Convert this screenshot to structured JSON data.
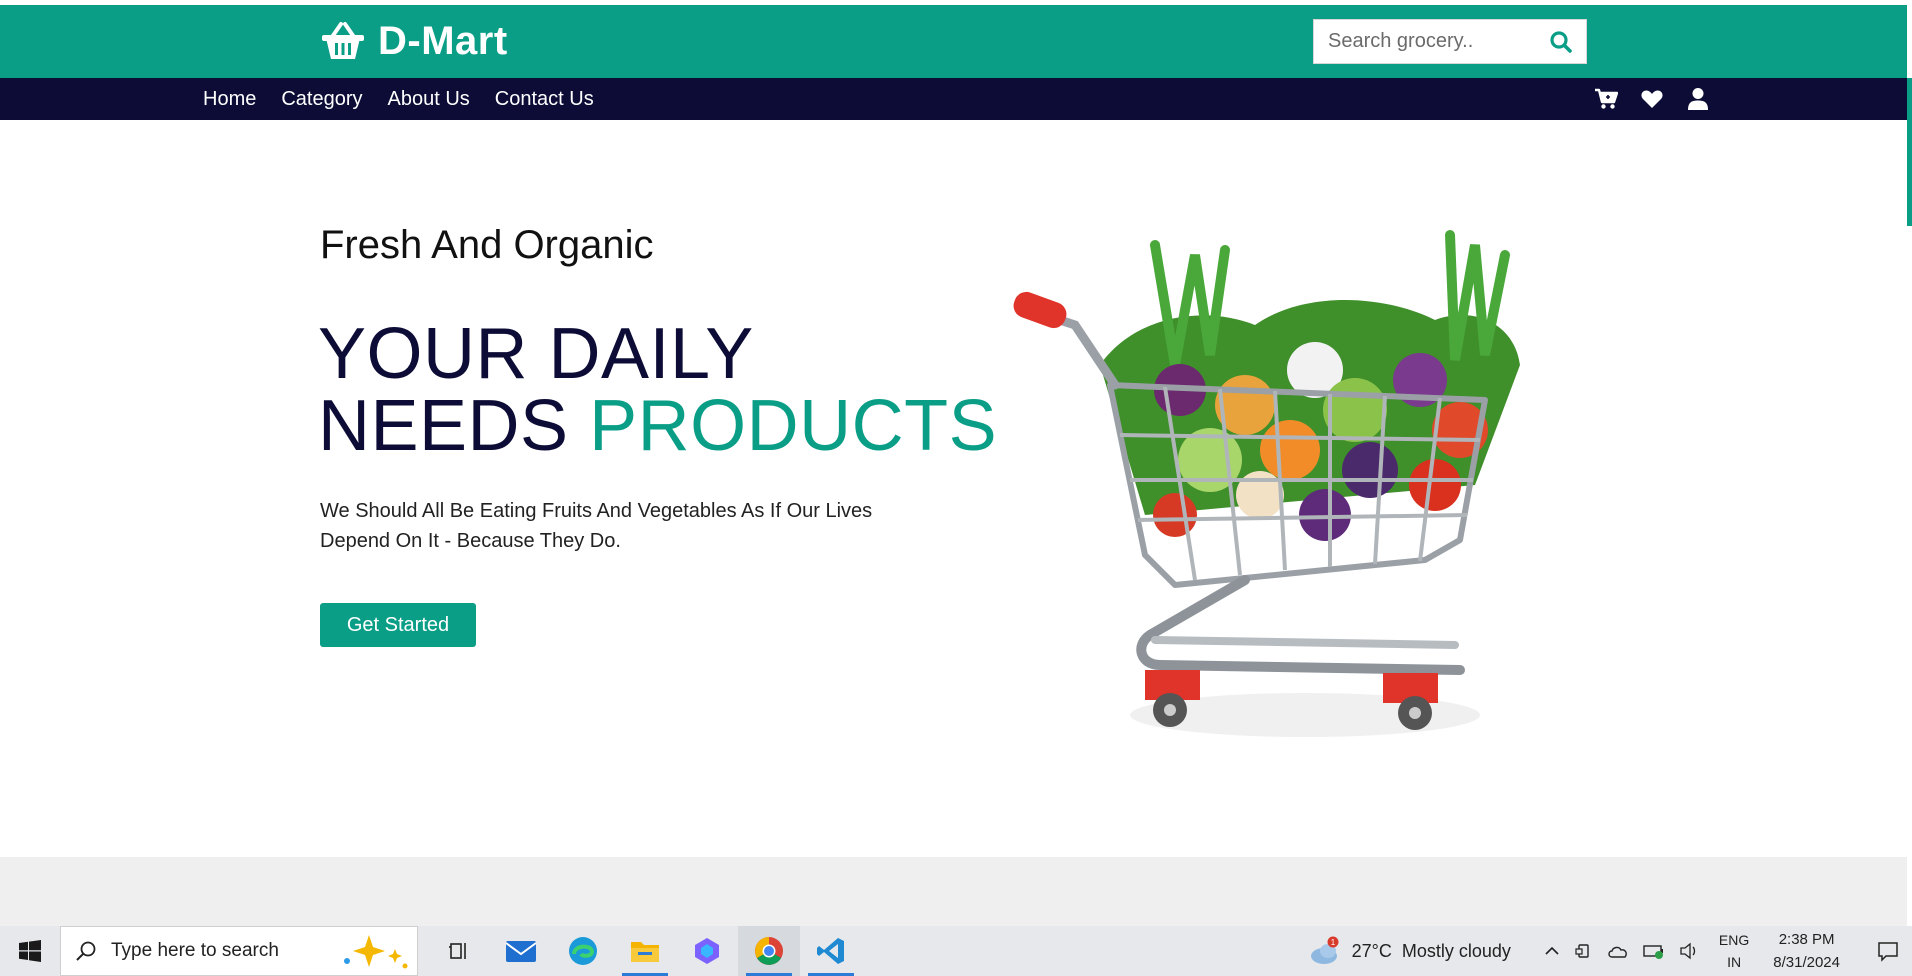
{
  "header": {
    "logo_text": "D-Mart",
    "search_placeholder": "Search grocery..",
    "brand_color": "#0a9e87",
    "nav_color": "#0c0c36"
  },
  "nav": {
    "links": [
      "Home",
      "Category",
      "About Us",
      "Contact Us"
    ],
    "icons": [
      "cart-icon",
      "heart-icon",
      "user-icon"
    ]
  },
  "hero": {
    "eyebrow": "Fresh And Organic",
    "headline_line1": "YOUR DAILY",
    "headline_line2_part1": "NEEDS ",
    "headline_line2_accent": "PRODUCTS",
    "description": "We Should All Be Eating Fruits And Vegetables As If Our Lives Depend On It - Because They Do.",
    "cta_label": "Get Started",
    "image": "shopping-cart-with-vegetables"
  },
  "taskbar": {
    "search_placeholder": "Type here to search",
    "apps": [
      "task-view",
      "mail",
      "edge",
      "file-explorer",
      "copilot",
      "chrome",
      "vscode"
    ],
    "weather_badge": "1",
    "weather_temp": "27°C",
    "weather_desc": "Mostly cloudy",
    "lang_top": "ENG",
    "lang_bottom": "IN",
    "time": "2:38 PM",
    "date": "8/31/2024"
  }
}
